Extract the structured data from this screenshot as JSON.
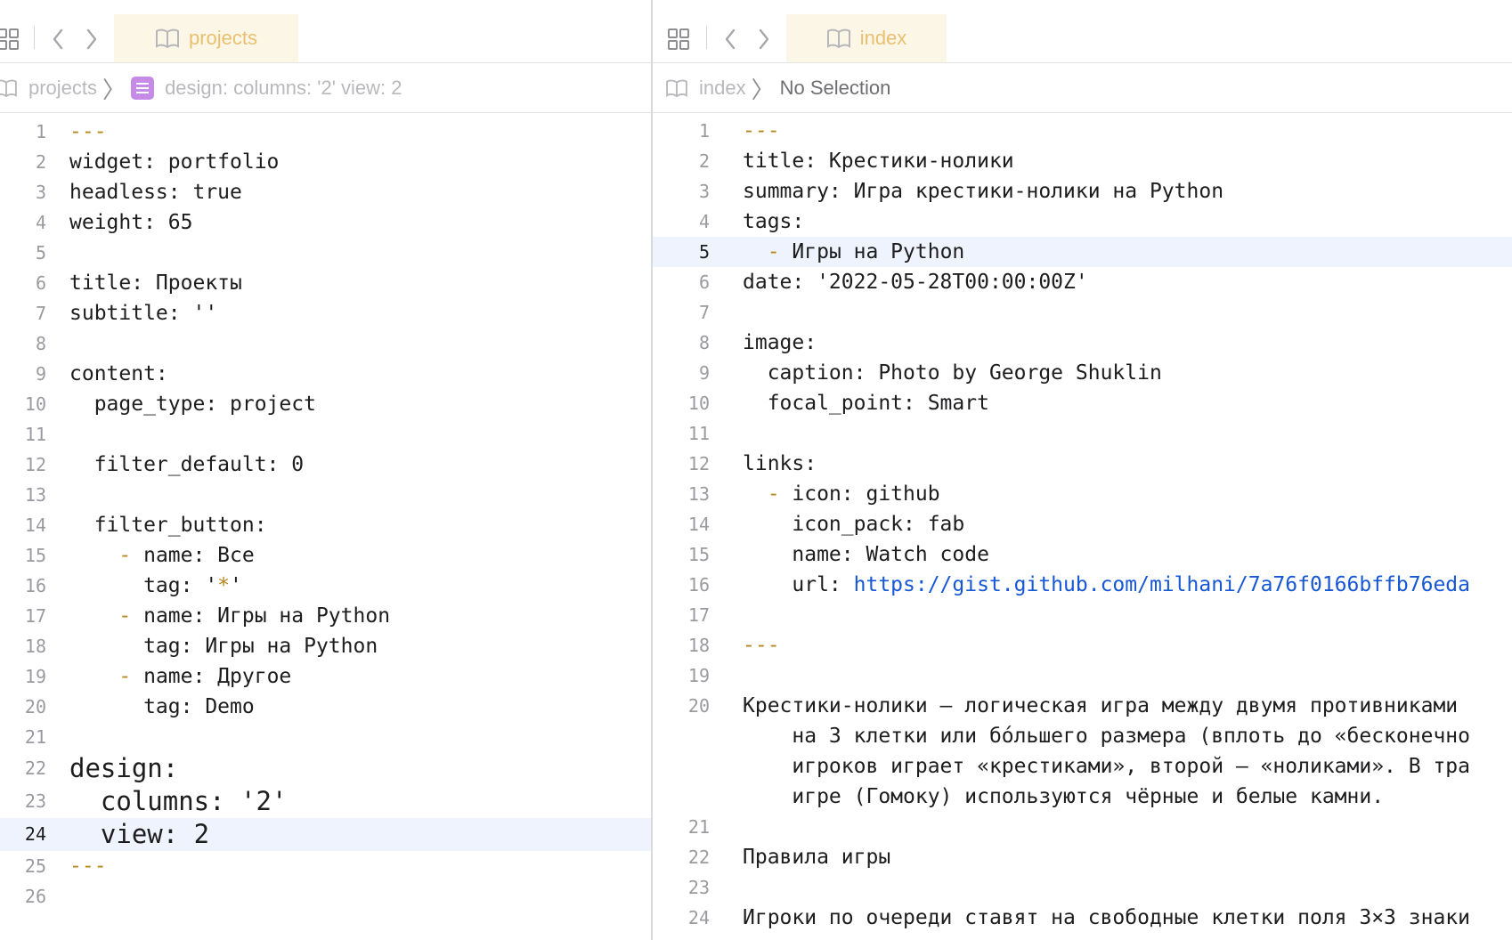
{
  "left": {
    "tab_title": "projects",
    "breadcrumb": {
      "file": "projects",
      "symbol": "design: columns: '2' view: 2"
    },
    "current_line": 24,
    "lines": [
      {
        "n": "1",
        "parts": [
          {
            "t": "---",
            "c": "dash"
          }
        ]
      },
      {
        "n": "2",
        "parts": [
          {
            "t": "widget: portfolio"
          }
        ]
      },
      {
        "n": "3",
        "parts": [
          {
            "t": "headless: true"
          }
        ]
      },
      {
        "n": "4",
        "parts": [
          {
            "t": "weight: 65"
          }
        ]
      },
      {
        "n": "5",
        "parts": []
      },
      {
        "n": "6",
        "parts": [
          {
            "t": "title: Проекты"
          }
        ]
      },
      {
        "n": "7",
        "parts": [
          {
            "t": "subtitle: ''"
          }
        ]
      },
      {
        "n": "8",
        "parts": []
      },
      {
        "n": "9",
        "parts": [
          {
            "t": "content:"
          }
        ]
      },
      {
        "n": "10",
        "parts": [
          {
            "t": "  page_type: project"
          }
        ]
      },
      {
        "n": "11",
        "parts": []
      },
      {
        "n": "12",
        "parts": [
          {
            "t": "  filter_default: 0"
          }
        ]
      },
      {
        "n": "13",
        "parts": []
      },
      {
        "n": "14",
        "parts": [
          {
            "t": "  filter_button:"
          }
        ]
      },
      {
        "n": "15",
        "parts": [
          {
            "t": "    "
          },
          {
            "t": "-",
            "c": "dash"
          },
          {
            "t": " name: Все"
          }
        ]
      },
      {
        "n": "16",
        "parts": [
          {
            "t": "      tag: '"
          },
          {
            "t": "*",
            "c": "dash"
          },
          {
            "t": "'"
          }
        ]
      },
      {
        "n": "17",
        "parts": [
          {
            "t": "    "
          },
          {
            "t": "-",
            "c": "dash"
          },
          {
            "t": " name: Игры на Python"
          }
        ]
      },
      {
        "n": "18",
        "parts": [
          {
            "t": "      tag: Игры на Python"
          }
        ]
      },
      {
        "n": "19",
        "parts": [
          {
            "t": "    "
          },
          {
            "t": "-",
            "c": "dash"
          },
          {
            "t": " name: Другое"
          }
        ]
      },
      {
        "n": "20",
        "parts": [
          {
            "t": "      tag: Demo"
          }
        ]
      },
      {
        "n": "21",
        "parts": []
      },
      {
        "n": "22",
        "big": true,
        "parts": [
          {
            "t": "design:"
          }
        ]
      },
      {
        "n": "23",
        "big": true,
        "parts": [
          {
            "t": "  columns: '2'"
          }
        ]
      },
      {
        "n": "24",
        "big": true,
        "parts": [
          {
            "t": "  view: 2"
          }
        ]
      },
      {
        "n": "25",
        "parts": [
          {
            "t": "---",
            "c": "dash"
          }
        ]
      },
      {
        "n": "26",
        "parts": []
      }
    ]
  },
  "right": {
    "tab_title": "index",
    "breadcrumb": {
      "file": "index",
      "symbol": "No Selection"
    },
    "current_line": 5,
    "lines": [
      {
        "n": "1",
        "parts": [
          {
            "t": "---",
            "c": "dash"
          }
        ]
      },
      {
        "n": "2",
        "parts": [
          {
            "t": "title: Крестики-нолики"
          }
        ]
      },
      {
        "n": "3",
        "parts": [
          {
            "t": "summary: Игра крестики-нолики на Python"
          }
        ]
      },
      {
        "n": "4",
        "parts": [
          {
            "t": "tags:"
          }
        ]
      },
      {
        "n": "5",
        "parts": [
          {
            "t": "  "
          },
          {
            "t": "-",
            "c": "dash"
          },
          {
            "t": " Игры на Python"
          }
        ]
      },
      {
        "n": "6",
        "parts": [
          {
            "t": "date: '2022-05-28T00:00:00Z'"
          }
        ]
      },
      {
        "n": "7",
        "parts": []
      },
      {
        "n": "8",
        "parts": [
          {
            "t": "image:"
          }
        ]
      },
      {
        "n": "9",
        "parts": [
          {
            "t": "  caption: Photo by George Shuklin"
          }
        ]
      },
      {
        "n": "10",
        "parts": [
          {
            "t": "  focal_point: Smart"
          }
        ]
      },
      {
        "n": "11",
        "parts": []
      },
      {
        "n": "12",
        "parts": [
          {
            "t": "links:"
          }
        ]
      },
      {
        "n": "13",
        "parts": [
          {
            "t": "  "
          },
          {
            "t": "-",
            "c": "dash"
          },
          {
            "t": " icon: github"
          }
        ]
      },
      {
        "n": "14",
        "parts": [
          {
            "t": "    icon_pack: fab"
          }
        ]
      },
      {
        "n": "15",
        "parts": [
          {
            "t": "    name: Watch code"
          }
        ]
      },
      {
        "n": "16",
        "parts": [
          {
            "t": "    url: "
          },
          {
            "t": "https://gist.github.com/milhani/7a76f0166bffb76eda",
            "c": "url"
          }
        ]
      },
      {
        "n": "17",
        "parts": []
      },
      {
        "n": "18",
        "parts": [
          {
            "t": "---",
            "c": "dash"
          }
        ]
      },
      {
        "n": "19",
        "parts": []
      },
      {
        "n": "20",
        "parts": [
          {
            "t": "Крестики-нолики — логическая игра между двумя противниками"
          }
        ]
      },
      {
        "n": "",
        "parts": [
          {
            "t": "    на 3 клетки или бо́льшего размера (вплоть до «бесконечно"
          }
        ]
      },
      {
        "n": "",
        "parts": [
          {
            "t": "    игроков играет «крестиками», второй — «ноликами». В тра"
          }
        ]
      },
      {
        "n": "",
        "parts": [
          {
            "t": "    игре (Гомоку) используются чёрные и белые камни."
          }
        ]
      },
      {
        "n": "21",
        "parts": []
      },
      {
        "n": "22",
        "parts": [
          {
            "t": "Правила игры"
          }
        ]
      },
      {
        "n": "23",
        "parts": []
      },
      {
        "n": "24",
        "parts": [
          {
            "t": "Игроки по очереди ставят на свободные клетки поля 3×3 знаки"
          }
        ]
      }
    ]
  }
}
